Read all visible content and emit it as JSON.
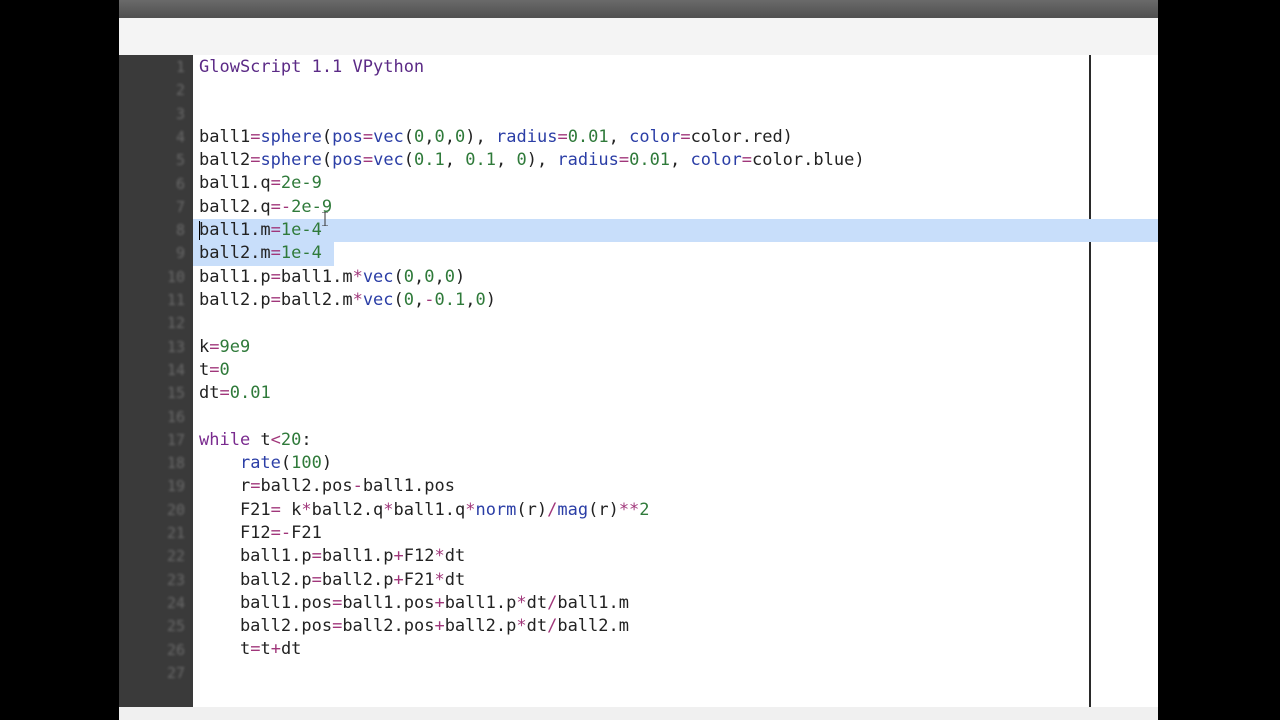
{
  "editor": {
    "header": "GlowScript 1.1 VPython",
    "lines": [
      {
        "n": "1",
        "segments": [
          {
            "t": "GlowScript 1.1 VPython",
            "c": "title-line"
          }
        ]
      },
      {
        "n": "2",
        "segments": []
      },
      {
        "n": "3",
        "segments": []
      },
      {
        "n": "4",
        "segments": [
          {
            "t": "ball1"
          },
          {
            "t": "=",
            "c": "op"
          },
          {
            "t": "sphere",
            "c": "fn"
          },
          {
            "t": "("
          },
          {
            "t": "pos",
            "c": "fn"
          },
          {
            "t": "=",
            "c": "op"
          },
          {
            "t": "vec",
            "c": "fn"
          },
          {
            "t": "("
          },
          {
            "t": "0",
            "c": "num"
          },
          {
            "t": ","
          },
          {
            "t": "0",
            "c": "num"
          },
          {
            "t": ","
          },
          {
            "t": "0",
            "c": "num"
          },
          {
            "t": "), "
          },
          {
            "t": "radius",
            "c": "fn"
          },
          {
            "t": "=",
            "c": "op"
          },
          {
            "t": "0.01",
            "c": "num"
          },
          {
            "t": ", "
          },
          {
            "t": "color",
            "c": "fn"
          },
          {
            "t": "=",
            "c": "op"
          },
          {
            "t": "color.red)"
          }
        ]
      },
      {
        "n": "5",
        "segments": [
          {
            "t": "ball2"
          },
          {
            "t": "=",
            "c": "op"
          },
          {
            "t": "sphere",
            "c": "fn"
          },
          {
            "t": "("
          },
          {
            "t": "pos",
            "c": "fn"
          },
          {
            "t": "=",
            "c": "op"
          },
          {
            "t": "vec",
            "c": "fn"
          },
          {
            "t": "("
          },
          {
            "t": "0.1",
            "c": "num"
          },
          {
            "t": ", "
          },
          {
            "t": "0.1",
            "c": "num"
          },
          {
            "t": ", "
          },
          {
            "t": "0",
            "c": "num"
          },
          {
            "t": "), "
          },
          {
            "t": "radius",
            "c": "fn"
          },
          {
            "t": "=",
            "c": "op"
          },
          {
            "t": "0.01",
            "c": "num"
          },
          {
            "t": ", "
          },
          {
            "t": "color",
            "c": "fn"
          },
          {
            "t": "=",
            "c": "op"
          },
          {
            "t": "color.blue)"
          }
        ]
      },
      {
        "n": "6",
        "segments": [
          {
            "t": "ball1.q"
          },
          {
            "t": "=",
            "c": "op"
          },
          {
            "t": "2e-9",
            "c": "num"
          }
        ]
      },
      {
        "n": "7",
        "segments": [
          {
            "t": "ball2.q"
          },
          {
            "t": "=",
            "c": "op"
          },
          {
            "t": "-",
            "c": "op"
          },
          {
            "t": "2e-9",
            "c": "num"
          }
        ]
      },
      {
        "n": "8",
        "segments": [
          {
            "t": "ball1.m"
          },
          {
            "t": "=",
            "c": "op"
          },
          {
            "t": "1e-4",
            "c": "num"
          }
        ]
      },
      {
        "n": "9",
        "segments": [
          {
            "t": "ball2.m"
          },
          {
            "t": "=",
            "c": "op"
          },
          {
            "t": "1e-4",
            "c": "num"
          }
        ]
      },
      {
        "n": "10",
        "segments": [
          {
            "t": "ball1.p"
          },
          {
            "t": "=",
            "c": "op"
          },
          {
            "t": "ball1.m"
          },
          {
            "t": "*",
            "c": "op"
          },
          {
            "t": "vec",
            "c": "fn"
          },
          {
            "t": "("
          },
          {
            "t": "0",
            "c": "num"
          },
          {
            "t": ","
          },
          {
            "t": "0",
            "c": "num"
          },
          {
            "t": ","
          },
          {
            "t": "0",
            "c": "num"
          },
          {
            "t": ")"
          }
        ]
      },
      {
        "n": "11",
        "segments": [
          {
            "t": "ball2.p"
          },
          {
            "t": "=",
            "c": "op"
          },
          {
            "t": "ball2.m"
          },
          {
            "t": "*",
            "c": "op"
          },
          {
            "t": "vec",
            "c": "fn"
          },
          {
            "t": "("
          },
          {
            "t": "0",
            "c": "num"
          },
          {
            "t": ","
          },
          {
            "t": "-",
            "c": "op"
          },
          {
            "t": "0.1",
            "c": "num"
          },
          {
            "t": ","
          },
          {
            "t": "0",
            "c": "num"
          },
          {
            "t": ")"
          }
        ]
      },
      {
        "n": "12",
        "segments": []
      },
      {
        "n": "13",
        "segments": [
          {
            "t": "k"
          },
          {
            "t": "=",
            "c": "op"
          },
          {
            "t": "9e9",
            "c": "num"
          }
        ]
      },
      {
        "n": "14",
        "segments": [
          {
            "t": "t"
          },
          {
            "t": "=",
            "c": "op"
          },
          {
            "t": "0",
            "c": "num"
          }
        ]
      },
      {
        "n": "15",
        "segments": [
          {
            "t": "dt"
          },
          {
            "t": "=",
            "c": "op"
          },
          {
            "t": "0.01",
            "c": "num"
          }
        ]
      },
      {
        "n": "16",
        "segments": []
      },
      {
        "n": "17",
        "segments": [
          {
            "t": "while",
            "c": "kw"
          },
          {
            "t": " t"
          },
          {
            "t": "<",
            "c": "op"
          },
          {
            "t": "20",
            "c": "num"
          },
          {
            "t": ":"
          }
        ]
      },
      {
        "n": "18",
        "segments": [
          {
            "t": "    "
          },
          {
            "t": "rate",
            "c": "fn"
          },
          {
            "t": "("
          },
          {
            "t": "100",
            "c": "num"
          },
          {
            "t": ")"
          }
        ]
      },
      {
        "n": "19",
        "segments": [
          {
            "t": "    r"
          },
          {
            "t": "=",
            "c": "op"
          },
          {
            "t": "ball2.pos"
          },
          {
            "t": "-",
            "c": "op"
          },
          {
            "t": "ball1.pos"
          }
        ]
      },
      {
        "n": "20",
        "segments": [
          {
            "t": "    F21"
          },
          {
            "t": "=",
            "c": "op"
          },
          {
            "t": " k"
          },
          {
            "t": "*",
            "c": "op"
          },
          {
            "t": "ball2.q"
          },
          {
            "t": "*",
            "c": "op"
          },
          {
            "t": "ball1.q"
          },
          {
            "t": "*",
            "c": "op"
          },
          {
            "t": "norm",
            "c": "fn"
          },
          {
            "t": "(r)"
          },
          {
            "t": "/",
            "c": "op"
          },
          {
            "t": "mag",
            "c": "fn"
          },
          {
            "t": "(r)"
          },
          {
            "t": "**",
            "c": "op"
          },
          {
            "t": "2",
            "c": "num"
          }
        ]
      },
      {
        "n": "21",
        "segments": [
          {
            "t": "    F12"
          },
          {
            "t": "=",
            "c": "op"
          },
          {
            "t": "-",
            "c": "op"
          },
          {
            "t": "F21"
          }
        ]
      },
      {
        "n": "22",
        "segments": [
          {
            "t": "    ball1.p"
          },
          {
            "t": "=",
            "c": "op"
          },
          {
            "t": "ball1.p"
          },
          {
            "t": "+",
            "c": "op"
          },
          {
            "t": "F12"
          },
          {
            "t": "*",
            "c": "op"
          },
          {
            "t": "dt"
          }
        ]
      },
      {
        "n": "23",
        "segments": [
          {
            "t": "    ball2.p"
          },
          {
            "t": "=",
            "c": "op"
          },
          {
            "t": "ball2.p"
          },
          {
            "t": "+",
            "c": "op"
          },
          {
            "t": "F21"
          },
          {
            "t": "*",
            "c": "op"
          },
          {
            "t": "dt"
          }
        ]
      },
      {
        "n": "24",
        "segments": [
          {
            "t": "    ball1.pos"
          },
          {
            "t": "=",
            "c": "op"
          },
          {
            "t": "ball1.pos"
          },
          {
            "t": "+",
            "c": "op"
          },
          {
            "t": "ball1.p"
          },
          {
            "t": "*",
            "c": "op"
          },
          {
            "t": "dt"
          },
          {
            "t": "/",
            "c": "op"
          },
          {
            "t": "ball1.m"
          }
        ]
      },
      {
        "n": "25",
        "segments": [
          {
            "t": "    ball2.pos"
          },
          {
            "t": "=",
            "c": "op"
          },
          {
            "t": "ball2.pos"
          },
          {
            "t": "+",
            "c": "op"
          },
          {
            "t": "ball2.p"
          },
          {
            "t": "*",
            "c": "op"
          },
          {
            "t": "dt"
          },
          {
            "t": "/",
            "c": "op"
          },
          {
            "t": "ball2.m"
          }
        ]
      },
      {
        "n": "26",
        "segments": [
          {
            "t": "    t"
          },
          {
            "t": "=",
            "c": "op"
          },
          {
            "t": "t"
          },
          {
            "t": "+",
            "c": "op"
          },
          {
            "t": "dt"
          }
        ]
      },
      {
        "n": "27",
        "segments": []
      }
    ]
  }
}
